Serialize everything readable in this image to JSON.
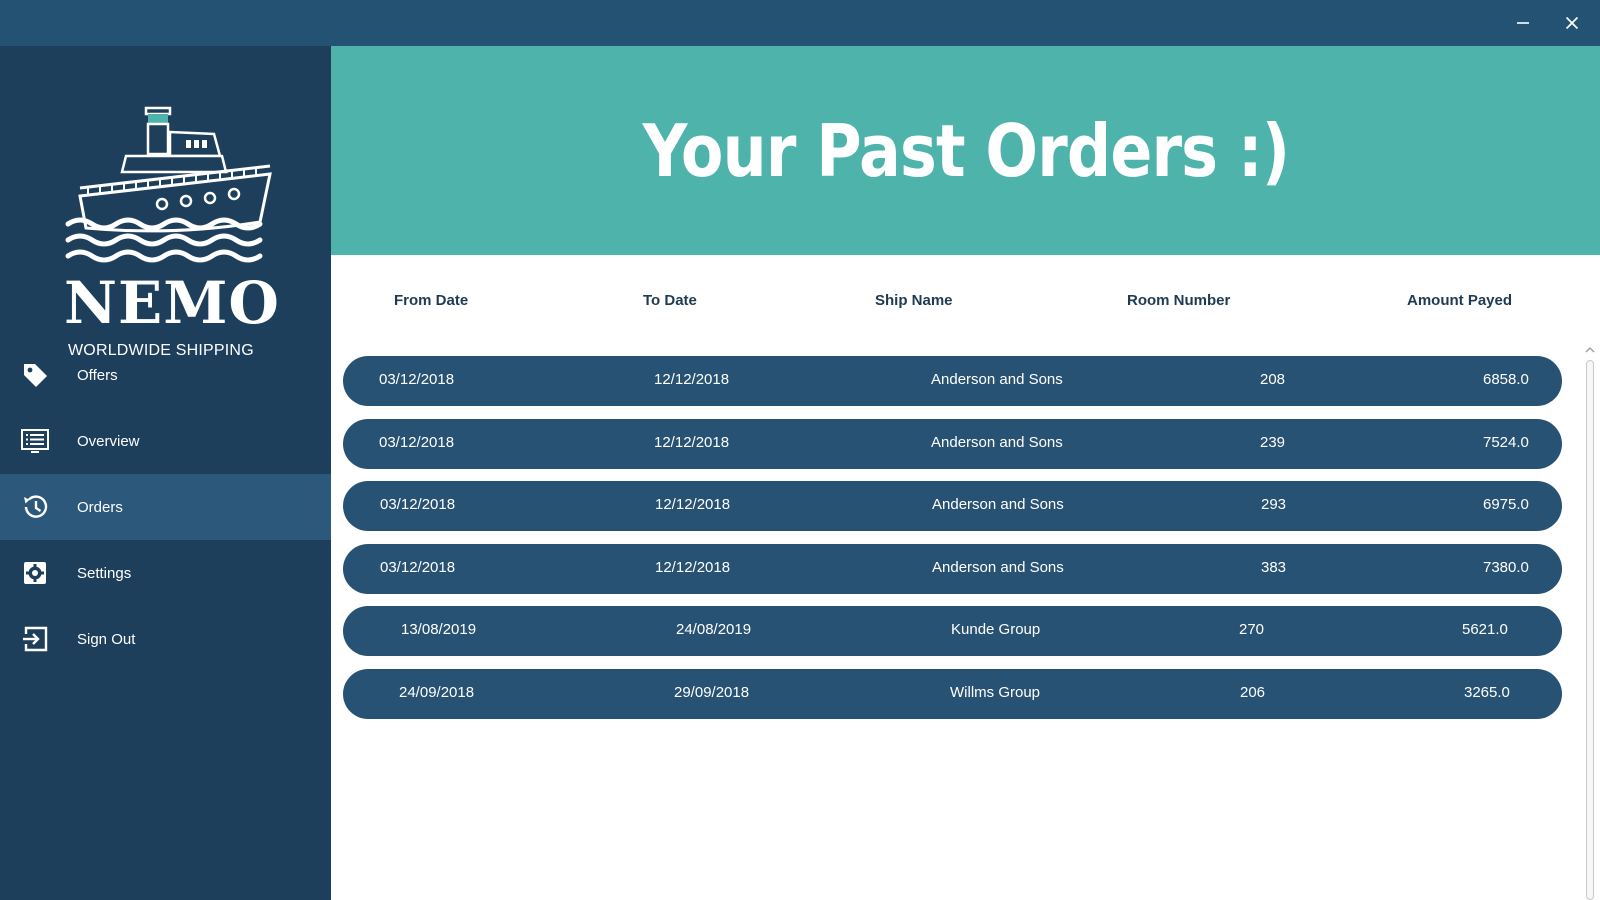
{
  "window": {
    "minimize_icon": "minimize-icon",
    "close_icon": "close-icon",
    "titlebar_color": "#235273"
  },
  "brand": {
    "name": "NEMO",
    "tagline": "WORLDWIDE SHIPPING",
    "logo_icon": "ship-icon"
  },
  "sidebar": {
    "bg_color": "#1d3f5c",
    "active_color": "#2b587b",
    "items": [
      {
        "label": "Offers",
        "icon": "tag-icon",
        "active": false
      },
      {
        "label": "Overview",
        "icon": "list-icon",
        "active": false
      },
      {
        "label": "Orders",
        "icon": "history-icon",
        "active": true
      },
      {
        "label": "Settings",
        "icon": "gear-icon",
        "active": false
      },
      {
        "label": "Sign Out",
        "icon": "sign-out-icon",
        "active": false
      }
    ]
  },
  "banner": {
    "title": "Your Past Orders :)",
    "color": "#4db3ab"
  },
  "table": {
    "columns": [
      "From Date",
      "To Date",
      "Ship Name",
      "Room Number",
      "Amount Payed"
    ],
    "row_color": "#285273",
    "rows": [
      [
        "03/12/2018",
        "12/12/2018",
        "Anderson and Sons",
        "208",
        "6858.0"
      ],
      [
        "03/12/2018",
        "12/12/2018",
        "Anderson and Sons",
        "239",
        "7524.0"
      ],
      [
        "03/12/2018",
        "12/12/2018",
        "Anderson and Sons",
        "293",
        "6975.0"
      ],
      [
        "03/12/2018",
        "12/12/2018",
        "Anderson and Sons",
        "383",
        "7380.0"
      ],
      [
        "13/08/2019",
        "24/08/2019",
        "Kunde Group",
        "270",
        "5621.0"
      ],
      [
        "24/09/2018",
        "29/09/2018",
        "Willms Group",
        "206",
        "3265.0"
      ]
    ]
  }
}
